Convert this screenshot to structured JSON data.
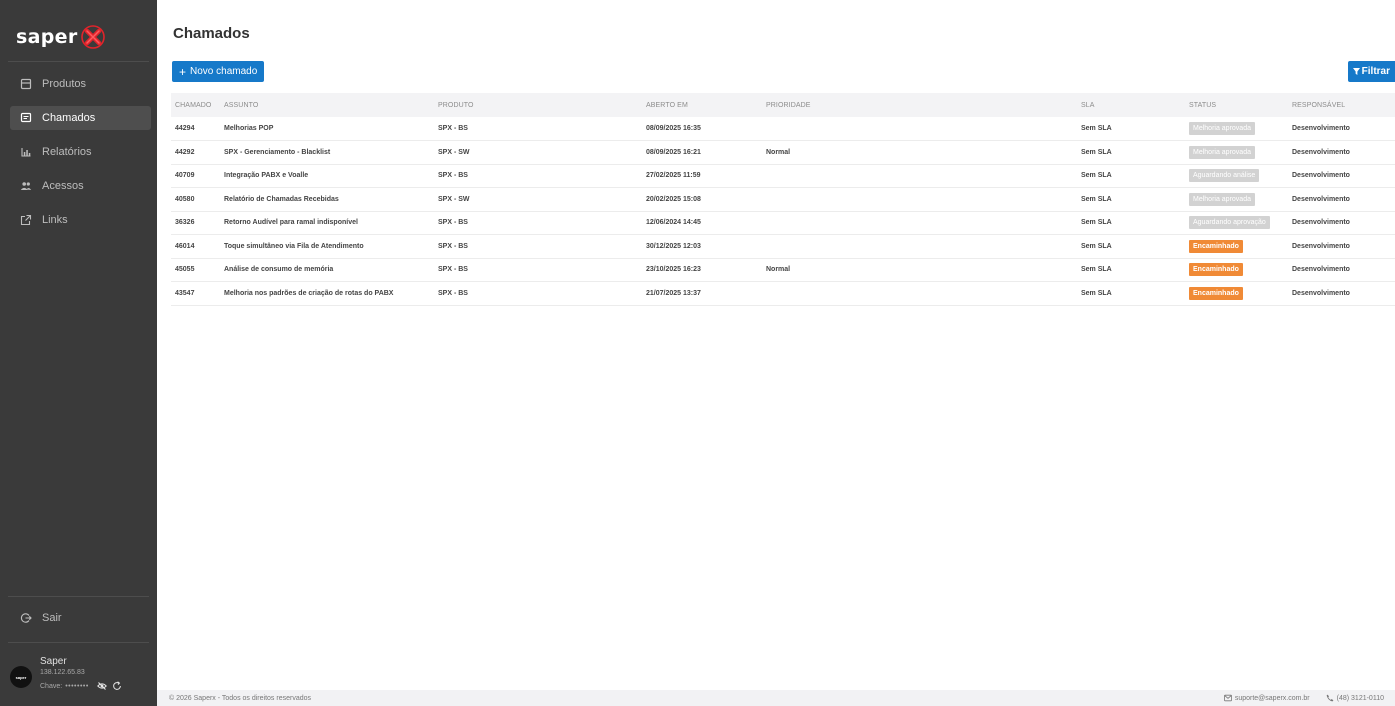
{
  "brand": {
    "name": "saper"
  },
  "sidebar": {
    "items": [
      {
        "label": "Produtos",
        "icon": "box-icon"
      },
      {
        "label": "Chamados",
        "icon": "ticket-icon"
      },
      {
        "label": "Relatórios",
        "icon": "bar-chart-icon"
      },
      {
        "label": "Acessos",
        "icon": "users-icon"
      },
      {
        "label": "Links",
        "icon": "external-link-icon"
      }
    ],
    "logout": "Sair",
    "user": {
      "name": "Saper",
      "ip": "138.122.65.83",
      "key_label": "Chave:",
      "key_masked": "••••••••"
    }
  },
  "page": {
    "title": "Chamados",
    "new_button": "Novo chamado",
    "filter_button": "Filtrar"
  },
  "table": {
    "headers": [
      "CHAMADO",
      "ASSUNTO",
      "PRODUTO",
      "ABERTO EM",
      "PRIORIDADE",
      "SLA",
      "STATUS",
      "RESPONSÁVEL"
    ],
    "rows": [
      [
        "44294",
        "Melhorias POP",
        "SPX - BS",
        "08/09/2025 16:35",
        "",
        "Sem SLA",
        "Melhoria aprovada",
        "Desenvolvimento"
      ],
      [
        "44292",
        "SPX - Gerenciamento - Blacklist",
        "SPX - SW",
        "08/09/2025 16:21",
        "Normal",
        "Sem SLA",
        "Melhoria aprovada",
        "Desenvolvimento"
      ],
      [
        "40709",
        "Integração PABX e Voalle",
        "SPX - BS",
        "27/02/2025 11:59",
        "",
        "Sem SLA",
        "Aguardando análise",
        "Desenvolvimento"
      ],
      [
        "40580",
        "Relatório de Chamadas Recebidas",
        "SPX - SW",
        "20/02/2025 15:08",
        "",
        "Sem SLA",
        "Melhoria aprovada",
        "Desenvolvimento"
      ],
      [
        "36326",
        "Retorno Audível para ramal indisponível",
        "SPX - BS",
        "12/06/2024 14:45",
        "",
        "Sem SLA",
        "Aguardando aprovação",
        "Desenvolvimento"
      ],
      [
        "46014",
        "Toque simultâneo via Fila de Atendimento",
        "SPX - BS",
        "30/12/2025 12:03",
        "",
        "Sem SLA",
        "Encaminhado",
        "Desenvolvimento"
      ],
      [
        "45055",
        "Análise de consumo de memória",
        "SPX - BS",
        "23/10/2025 16:23",
        "Normal",
        "Sem SLA",
        "Encaminhado",
        "Desenvolvimento"
      ],
      [
        "43547",
        "Melhoria nos padrões de criação de rotas do PABX",
        "SPX - BS",
        "21/07/2025 13:37",
        "",
        "Sem SLA",
        "Encaminhado",
        "Desenvolvimento"
      ]
    ],
    "status_colors": {
      "Melhoria aprovada": "#d2d2d2",
      "Aguardando análise": "#d2d2d2",
      "Aguardando aprovação": "#d2d2d2",
      "Encaminhado": "#f08a36"
    }
  },
  "footer": {
    "copyright": "© 2026 Saperx - Todos os direitos reservados",
    "email": "suporte@saperx.com.br",
    "phone": "(48) 3121-0110"
  },
  "colors": {
    "sidebar_bg": "#3a3a3a",
    "accent": "#1679c9",
    "logo_x": "#e0242b"
  }
}
